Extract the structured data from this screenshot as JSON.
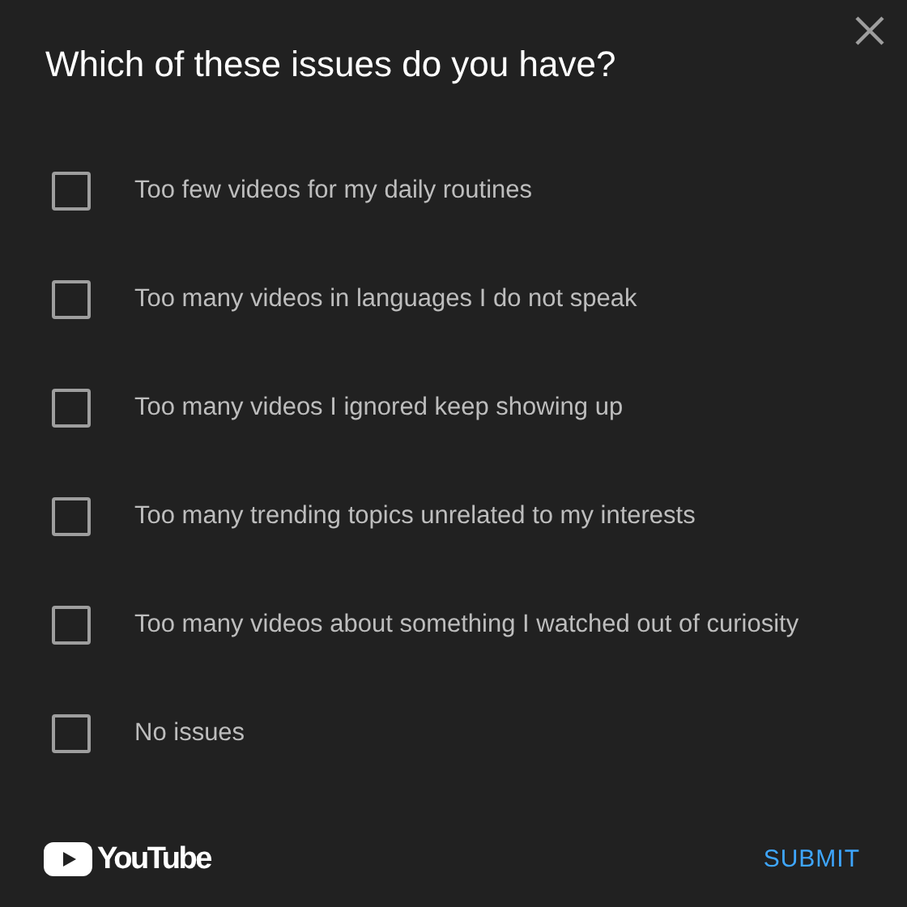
{
  "dialog": {
    "title": "Which of these issues do you have?"
  },
  "options": [
    {
      "label": "Too few videos for my daily routines",
      "checked": false
    },
    {
      "label": "Too many videos in languages I do not speak",
      "checked": false
    },
    {
      "label": "Too many videos I ignored keep showing up",
      "checked": false
    },
    {
      "label": "Too many trending topics unrelated to my interests",
      "checked": false
    },
    {
      "label": "Too many videos about something I watched out of curiosity",
      "checked": false
    },
    {
      "label": "No issues",
      "checked": false
    }
  ],
  "footer": {
    "logo_text": "YouTube",
    "submit": "SUBMIT"
  }
}
